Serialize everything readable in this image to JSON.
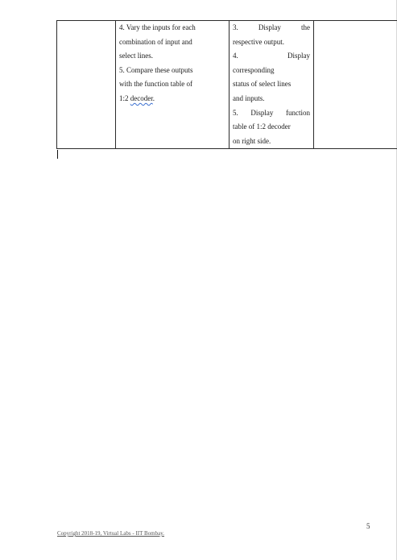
{
  "table": {
    "col2": {
      "line1": "4. Vary the inputs for each",
      "line2": "combination of input and",
      "line3": "select lines.",
      "line4": "5. Compare these outputs",
      "line5": "with the function table of",
      "line6_prefix": "1:2 ",
      "line6_word": "decoder",
      "line6_suffix": "."
    },
    "col3": {
      "l1a": "3.",
      "l1b": "Display",
      "l1c": "the",
      "l2": "respective output.",
      "l3a": "4.",
      "l3b": "Display",
      "l4": "corresponding",
      "l5": "status of select lines",
      "l6": "and inputs.",
      "l7a": "5.",
      "l7b": "Display",
      "l7c": "function",
      "l8": "table of 1:2 decoder",
      "l9": "on right side."
    }
  },
  "page_number": "5",
  "footer": "Copyright 2018-19, Virtual Labs - IIT Bombay."
}
